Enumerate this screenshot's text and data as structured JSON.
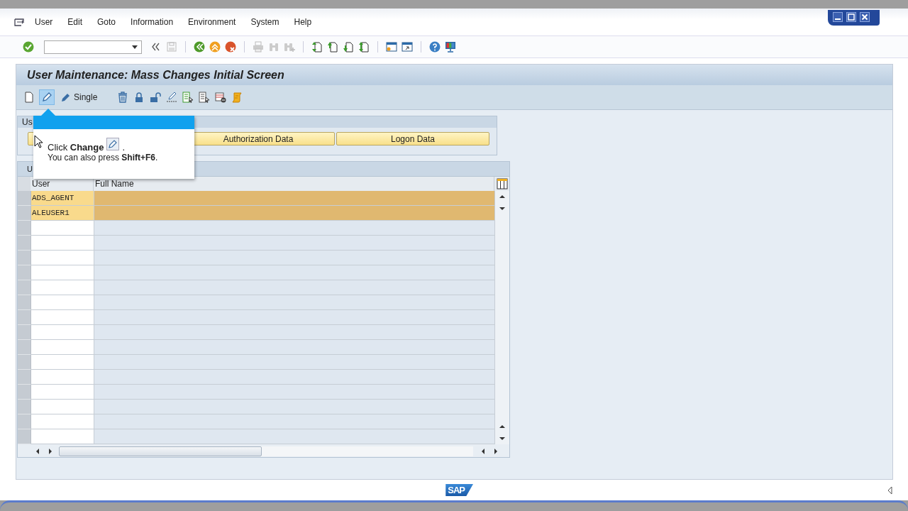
{
  "menu_bar": [
    "User",
    "Edit",
    "Goto",
    "Information",
    "Environment",
    "System",
    "Help"
  ],
  "screen_title": "User Maintenance: Mass Changes Initial Screen",
  "app_toolbar": {
    "change_pressed": true,
    "single_label": "Single"
  },
  "group_box": {
    "title": "Us",
    "buttons": [
      "Authorization Data",
      "Logon Data"
    ]
  },
  "table": {
    "title": "U",
    "columns": [
      "User",
      "Full Name"
    ],
    "rows": [
      {
        "user": "ADS_AGENT",
        "selected": true
      },
      {
        "user": "ALEUSER1",
        "selected": true
      }
    ]
  },
  "tooltip": {
    "line_1": "Click **Change**",
    "line_1_end": ".",
    "line_2": "You can also press **Shift+F6**."
  },
  "logo": "SAP"
}
